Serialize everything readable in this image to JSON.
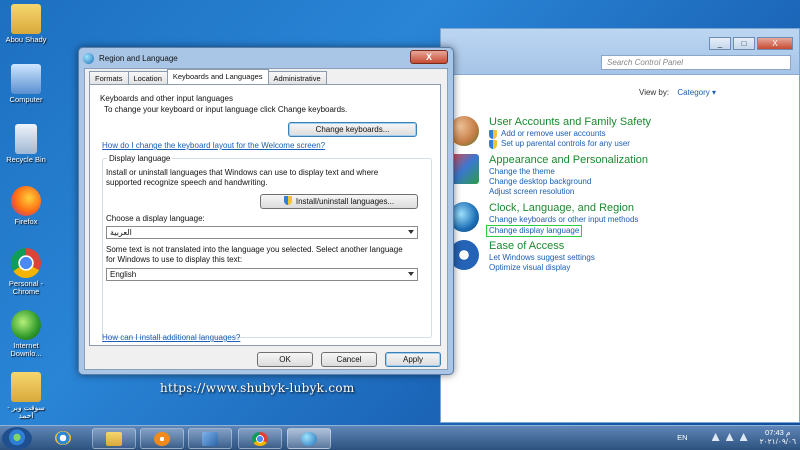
{
  "desktop": {
    "icons": [
      {
        "label": "Abou Shady"
      },
      {
        "label": "Computer"
      },
      {
        "label": "Recycle Bin"
      },
      {
        "label": "Firefox"
      },
      {
        "label": "Personal - Chrome"
      },
      {
        "label": "Internet Downlo..."
      },
      {
        "label": "سوفت وير - احمد"
      }
    ]
  },
  "control_panel": {
    "buttons": {
      "minimize": "_",
      "maximize": "□",
      "close": "X"
    },
    "search_placeholder": "Search Control Panel",
    "view_by_label": "View by:",
    "view_by_value": "Category ▾",
    "sections": [
      {
        "title": "User Accounts and Family Safety",
        "links": [
          "Add or remove user accounts",
          "Set up parental controls for any user"
        ]
      },
      {
        "title": "Appearance and Personalization",
        "links": [
          "Change the theme",
          "Change desktop background",
          "Adjust screen resolution"
        ]
      },
      {
        "title": "Clock, Language, and Region",
        "links": [
          "Change keyboards or other input methods",
          "Change display language"
        ]
      },
      {
        "title": "Ease of Access",
        "links": [
          "Let Windows suggest settings",
          "Optimize visual display"
        ]
      }
    ]
  },
  "dialog": {
    "title": "Region and Language",
    "close_label": "X",
    "tabs": [
      "Formats",
      "Location",
      "Keyboards and Languages",
      "Administrative"
    ],
    "keyboards_group": {
      "label": "Keyboards and other input languages",
      "text": "To change your keyboard or input language click Change keyboards.",
      "button": "Change keyboards...",
      "help_link": "How do I change the keyboard layout for the Welcome screen?"
    },
    "display_group": {
      "label": "Display language",
      "text": "Install or uninstall languages that Windows can use to display text and where supported recognize speech and handwriting.",
      "install_button": "Install/uninstall languages...",
      "choose_label": "Choose a display language:",
      "choose_value": "العربية",
      "note": "Some text is not translated into the language you selected. Select another language for Windows to use to display this text:",
      "fallback_value": "English"
    },
    "install_link": "How can I install additional languages?",
    "ok": "OK",
    "cancel": "Cancel",
    "apply": "Apply"
  },
  "watermark": "https://www.shubyk-lubyk.com",
  "taskbar": {
    "lang": "EN",
    "time": "07:43 م",
    "date": "٢٠٢١/٠٩/٠٦"
  }
}
